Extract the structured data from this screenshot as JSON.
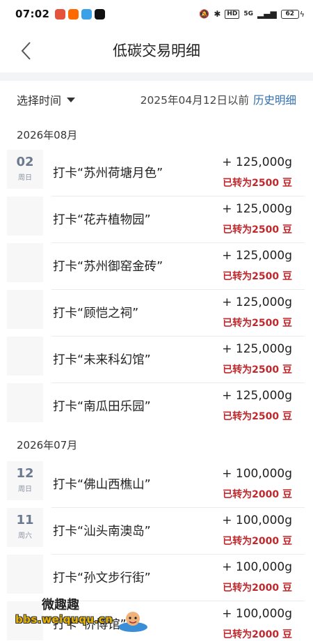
{
  "status_bar": {
    "time": "07:02",
    "apps": [
      {
        "icon": "app-icon-1",
        "color": "#e5533d"
      },
      {
        "icon": "taobao-icon",
        "color": "#ff6a00"
      },
      {
        "icon": "app-icon-3",
        "color": "#3aa0e8"
      },
      {
        "icon": "tiktok-icon",
        "color": "#111111"
      }
    ],
    "hd_label": "HD",
    "network_label": "5G",
    "battery_level": "62"
  },
  "header": {
    "title": "低碳交易明细"
  },
  "filter": {
    "select_label": "选择时间",
    "date_text": "2025年04月12日以前",
    "history_link": "历史明细"
  },
  "colors": {
    "accent_blue": "#2f6fae",
    "converted_red": "#c0282d",
    "date_text": "#6c7a90"
  },
  "months": [
    {
      "label": "2026年08月",
      "rows": [
        {
          "day": "02",
          "weekday": "周日",
          "title": "打卡“苏州荷塘月色”",
          "amount": "+ 125,000g",
          "converted": "已转为2500 豆"
        },
        {
          "day": "",
          "weekday": "",
          "title": "打卡“花卉植物园”",
          "amount": "+ 125,000g",
          "converted": "已转为2500 豆"
        },
        {
          "day": "",
          "weekday": "",
          "title": "打卡“苏州御窑金砖”",
          "amount": "+ 125,000g",
          "converted": "已转为2500 豆"
        },
        {
          "day": "",
          "weekday": "",
          "title": "打卡“顾恺之祠”",
          "amount": "+ 125,000g",
          "converted": "已转为2500 豆"
        },
        {
          "day": "",
          "weekday": "",
          "title": "打卡“未来科幻馆”",
          "amount": "+ 125,000g",
          "converted": "已转为2500 豆"
        },
        {
          "day": "",
          "weekday": "",
          "title": "打卡“南瓜田乐园”",
          "amount": "+ 125,000g",
          "converted": "已转为2500 豆"
        }
      ]
    },
    {
      "label": "2026年07月",
      "rows": [
        {
          "day": "12",
          "weekday": "周日",
          "title": "打卡“佛山西樵山”",
          "amount": "+ 100,000g",
          "converted": "已转为2000 豆"
        },
        {
          "day": "11",
          "weekday": "周六",
          "title": "打卡“汕头南澳岛”",
          "amount": "+ 100,000g",
          "converted": "已转为2000 豆"
        },
        {
          "day": "",
          "weekday": "",
          "title": "打卡“孙文步行街”",
          "amount": "+ 100,000g",
          "converted": "已转为2000 豆"
        },
        {
          "day": "",
          "weekday": "",
          "title": "打卡“侨博馆”",
          "amount": "+ 100,000g",
          "converted": "已转为2000 豆"
        }
      ]
    }
  ],
  "watermark": {
    "title": "微趣趣",
    "url": "bbs.weiququ.cn"
  }
}
